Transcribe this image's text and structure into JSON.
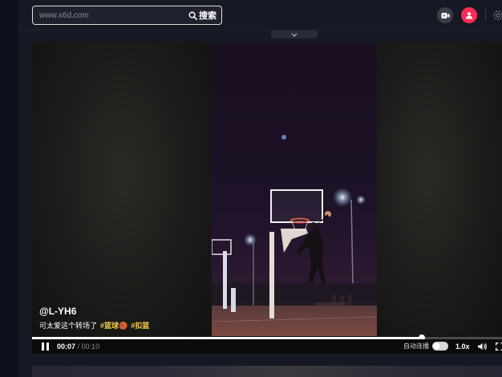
{
  "search": {
    "placeholder": "www.x6d.com",
    "button_label": "搜索"
  },
  "video": {
    "author": "@L-YH6",
    "description": "可太爱这个转场了",
    "hashtags": [
      "#篮球🏀",
      "#扣篮"
    ]
  },
  "player": {
    "current_time": "00:07",
    "separator": " / ",
    "duration": "00:10",
    "progress": 0.83,
    "autoplay_label": "自动连播",
    "speed_label": "1.0x"
  },
  "colors": {
    "accent": "#fe2c55",
    "hashtag": "#f7c948",
    "background": "#161823"
  },
  "icons": [
    "search-icon",
    "camera-icon",
    "user-icon",
    "settings-icon",
    "chevron-down-icon",
    "pause-icon",
    "volume-icon",
    "fullscreen-icon"
  ]
}
